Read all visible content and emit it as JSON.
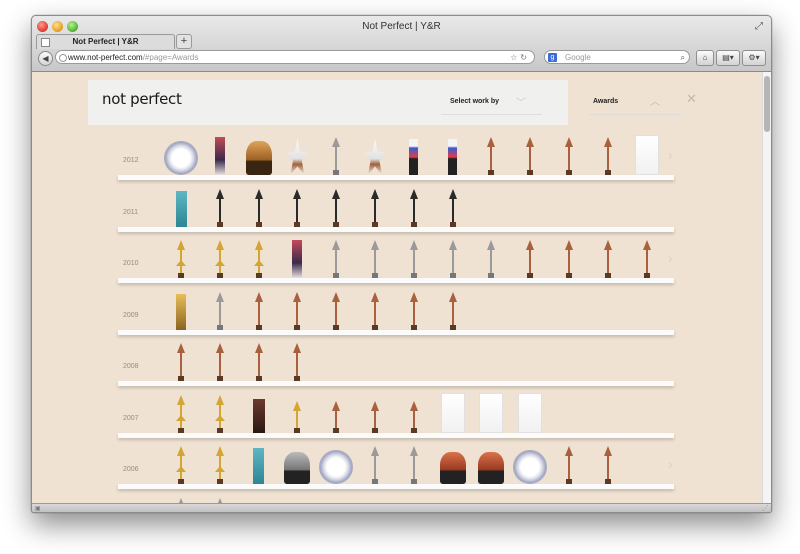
{
  "window": {
    "title": "Not Perfect | Y&R"
  },
  "tab": {
    "label": "Not Perfect | Y&R"
  },
  "address": {
    "domain": "www.not-perfect.com",
    "path": "/#page=Awards"
  },
  "search": {
    "placeholder": "Google"
  },
  "site": {
    "logo": "not perfect",
    "select_work": "Select work by",
    "awards": "Awards"
  },
  "icons": [
    "close-icon",
    "minimize-icon",
    "maximize-icon",
    "fullscreen-icon",
    "favicon-icon",
    "plus-icon",
    "back-arrow-icon",
    "globe-icon",
    "star-icon",
    "reload-icon",
    "google-icon",
    "magnifier-icon",
    "home-icon",
    "bookmarks-icon",
    "gear-icon",
    "chevron-down-icon",
    "chevron-up-icon",
    "chevron-right-icon"
  ],
  "colors": {
    "page_bg": "#efe2d2",
    "shelf": "#fbfbfb",
    "bronze": "#a9613d",
    "silver": "#9a9a9a",
    "gold": "#d3a531",
    "black": "#2a2a2a"
  },
  "shelves": [
    {
      "year": "2012",
      "trophies": [
        "plate",
        "crystal",
        "figurine",
        "star",
        "arrow-silver",
        "star",
        "tag-blue",
        "tag-blue",
        "arrow-bronze",
        "arrow-bronze",
        "arrow-bronze",
        "arrow-bronze",
        "card"
      ]
    },
    {
      "year": "2011",
      "trophies": [
        "block-teal",
        "arrow-black",
        "arrow-black",
        "arrow-black",
        "arrow-black",
        "arrow-black",
        "arrow-black",
        "arrow-black"
      ]
    },
    {
      "year": "2010",
      "trophies": [
        "arrow-gold",
        "arrow-gold",
        "arrow-gold",
        "crystal",
        "arrow-silver",
        "arrow-silver",
        "arrow-silver",
        "arrow-silver",
        "arrow-silver",
        "arrow-bronze",
        "arrow-bronze",
        "arrow-bronze",
        "arrow-bronze"
      ]
    },
    {
      "year": "2009",
      "trophies": [
        "statue-gold",
        "arrow-silver",
        "arrow-bronze",
        "arrow-bronze",
        "arrow-bronze",
        "arrow-bronze",
        "arrow-bronze",
        "arrow-bronze"
      ]
    },
    {
      "year": "2008",
      "trophies": [
        "arrow-bronze",
        "arrow-bronze",
        "arrow-bronze",
        "arrow-bronze"
      ]
    },
    {
      "year": "2007",
      "trophies": [
        "arrow-gold",
        "arrow-gold",
        "block-dark",
        "pin-gold",
        "pin-bronze",
        "pin-bronze",
        "pin-bronze",
        "card",
        "card",
        "card"
      ]
    },
    {
      "year": "2006",
      "trophies": [
        "arrow-gold",
        "arrow-gold",
        "block-teal",
        "figurine-dark",
        "plate",
        "arrow-silver",
        "arrow-silver",
        "figurine-copper",
        "figurine-copper",
        "plate",
        "arrow-bronze",
        "arrow-bronze"
      ]
    },
    {
      "year": "",
      "trophies": [
        "arrow-silver",
        "arrow-silver"
      ]
    }
  ]
}
